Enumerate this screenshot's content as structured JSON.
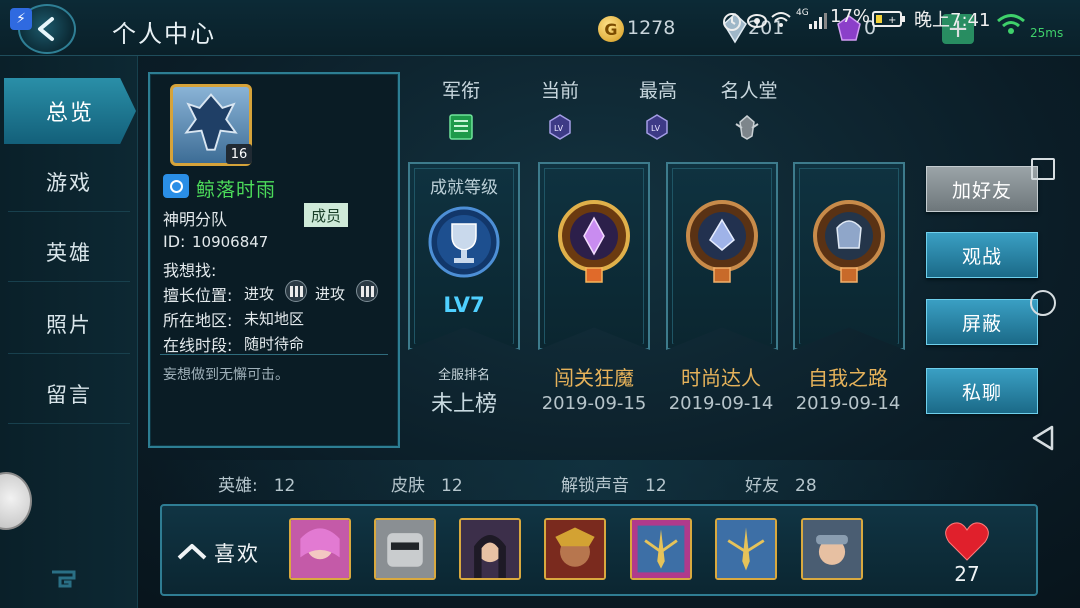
{
  "header": {
    "title": "个人中心",
    "coins": "1278",
    "diamonds": "201",
    "gems": "0",
    "plus_label": "+"
  },
  "status_bar": {
    "network": "4G",
    "battery": "17%",
    "time": "晚上7:41",
    "ping": "25ms"
  },
  "nav": {
    "items": [
      "总览",
      "游戏",
      "英雄",
      "照片",
      "留言"
    ],
    "active_index": 0
  },
  "profile": {
    "avatar_level": "16",
    "name": "鲸落时雨",
    "squad": "神明分队",
    "role_tag": "成员",
    "id_label": "ID:",
    "id_value": "10906847",
    "looking_for_label": "我想找:",
    "position_label": "擅长位置:",
    "position_1": "进攻",
    "position_2": "进攻",
    "region_label": "所在地区:",
    "region_value": "未知地区",
    "online_label": "在线时段:",
    "online_value": "随时待命",
    "signature": "妄想做到无懈可击。"
  },
  "ranks": {
    "headers": [
      "军衔",
      "当前",
      "最高",
      "名人堂"
    ]
  },
  "achievement": {
    "title": "成就等级",
    "level": "LV7",
    "rank_label": "全服排名",
    "rank_value": "未上榜"
  },
  "medals": [
    {
      "name": "闯关狂魔",
      "date": "2019-09-15"
    },
    {
      "name": "时尚达人",
      "date": "2019-09-14"
    },
    {
      "name": "自我之路",
      "date": "2019-09-14"
    }
  ],
  "actions": {
    "add_friend": "加好友",
    "spectate": "观战",
    "block": "屏蔽",
    "chat": "私聊"
  },
  "stats": {
    "heroes_label": "英雄:",
    "heroes_value": "12",
    "skins_label": "皮肤",
    "skins_value": "12",
    "voices_label": "解锁声音",
    "voices_value": "12",
    "friends_label": "好友",
    "friends_value": "28"
  },
  "likes": {
    "label": "喜欢",
    "count": "27"
  },
  "colors": {
    "accent": "#2f7f95",
    "name_green": "#4cdb5a",
    "medal_gold": "#e6b25a",
    "level_blue": "#4fd0ff"
  }
}
